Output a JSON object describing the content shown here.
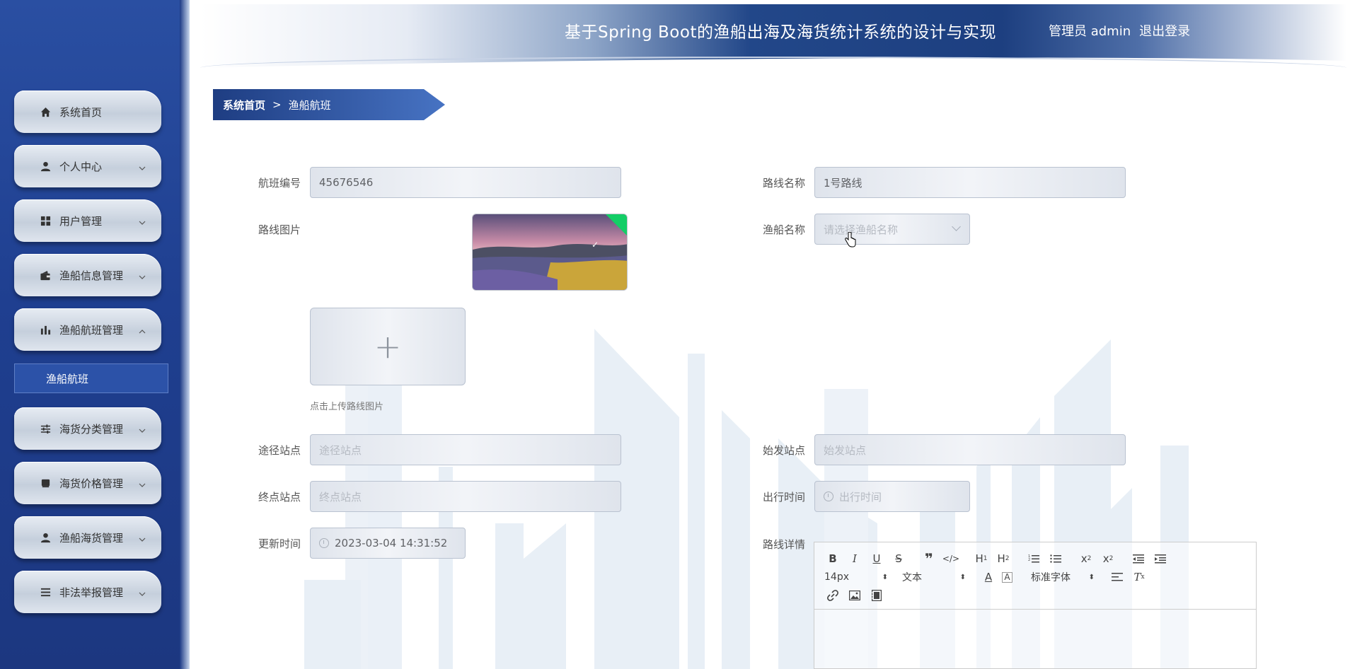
{
  "header": {
    "title": "基于Spring Boot的渔船出海及海货统计系统的设计与实现",
    "user_label": "管理员 admin",
    "logout_label": "退出登录"
  },
  "sidebar": {
    "items": [
      {
        "label": "系统首页",
        "icon": "home-icon",
        "has_children": false
      },
      {
        "label": "个人中心",
        "icon": "user-icon",
        "has_children": true
      },
      {
        "label": "用户管理",
        "icon": "grid-icon",
        "has_children": true
      },
      {
        "label": "渔船信息管理",
        "icon": "wallet-icon",
        "has_children": true
      },
      {
        "label": "渔船航班管理",
        "icon": "bar-chart-icon",
        "has_children": true,
        "expanded": true
      },
      {
        "label": "海货分类管理",
        "icon": "sliders-icon",
        "has_children": true
      },
      {
        "label": "海货价格管理",
        "icon": "box-icon",
        "has_children": true
      },
      {
        "label": "渔船海货管理",
        "icon": "user-icon",
        "has_children": true
      },
      {
        "label": "非法举报管理",
        "icon": "list-icon",
        "has_children": true
      }
    ],
    "sub_item": "渔船航班"
  },
  "breadcrumb": {
    "home": "系统首页",
    "separator": ">",
    "current": "渔船航班"
  },
  "form": {
    "flight_no": {
      "label": "航班编号",
      "value": "45676546"
    },
    "route_name": {
      "label": "路线名称",
      "value": "1号路线"
    },
    "route_image": {
      "label": "路线图片",
      "upload_tip": "点击上传路线图片"
    },
    "boat_name": {
      "label": "渔船名称",
      "placeholder": "请选择渔船名称"
    },
    "via_station": {
      "label": "途径站点",
      "placeholder": "途径站点"
    },
    "start_station": {
      "label": "始发站点",
      "placeholder": "始发站点"
    },
    "end_station": {
      "label": "终点站点",
      "placeholder": "终点站点"
    },
    "depart_time": {
      "label": "出行时间",
      "placeholder": "出行时间"
    },
    "update_time": {
      "label": "更新时间",
      "value": "2023-03-04 14:31:52"
    },
    "route_detail": {
      "label": "路线详情"
    }
  },
  "editor": {
    "font_size": "14px",
    "block_format": "文本",
    "font_family": "标准字体"
  },
  "colors": {
    "sidebar": "#1f3f90",
    "accent": "#2c52a8",
    "success": "#13ce66"
  }
}
